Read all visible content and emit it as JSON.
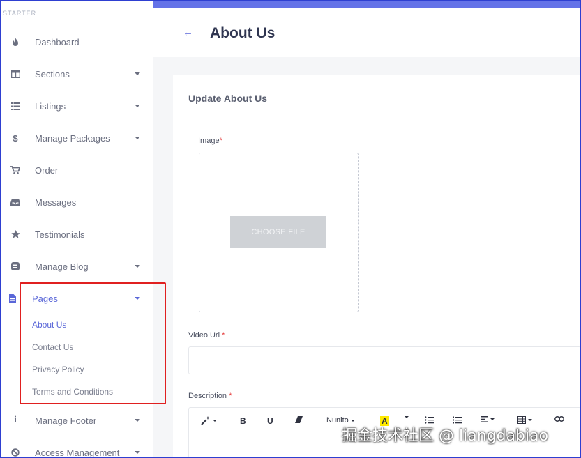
{
  "sidebar": {
    "brand": "STARTER",
    "items": [
      {
        "label": "Dashboard",
        "icon": "fire-icon"
      },
      {
        "label": "Sections",
        "icon": "columns-icon"
      },
      {
        "label": "Listings",
        "icon": "list-icon"
      },
      {
        "label": "Manage Packages",
        "icon": "dollar-icon"
      },
      {
        "label": "Order",
        "icon": "cart-icon"
      },
      {
        "label": "Messages",
        "icon": "inbox-icon"
      },
      {
        "label": "Testimonials",
        "icon": "star-icon"
      },
      {
        "label": "Manage Blog",
        "icon": "blog-icon"
      },
      {
        "label": "Pages",
        "icon": "file-icon"
      },
      {
        "label": "Manage Footer",
        "icon": "info-icon"
      },
      {
        "label": "Access Management",
        "icon": "ban-icon"
      }
    ],
    "pages_sub": [
      "About Us",
      "Contact Us",
      "Privacy Policy",
      "Terms and Conditions"
    ]
  },
  "header": {
    "title": "About Us",
    "back_icon": "arrow-left-icon"
  },
  "form": {
    "title": "Update About Us",
    "image_label": "Image",
    "choose_file": "CHOOSE FILE",
    "video_label": "Video Url",
    "description_label": "Description",
    "required_mark": "*",
    "font_name": "Nunito"
  },
  "watermark": "掘金技术社区 @ liangdabiao",
  "colors": {
    "accent": "#5a67d8",
    "topbar": "#6472e8",
    "highlight": "#e02020",
    "required": "#e53e3e"
  }
}
